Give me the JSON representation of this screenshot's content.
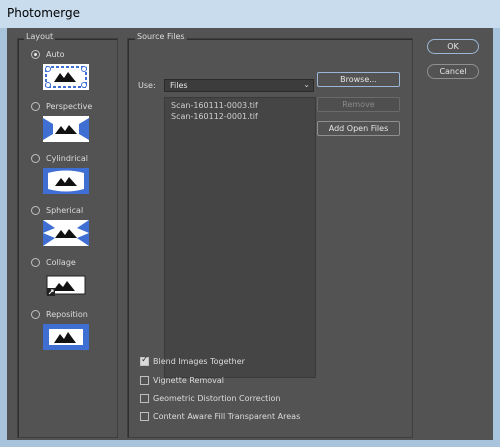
{
  "window": {
    "title": "Photomerge"
  },
  "layout": {
    "label": "Layout",
    "options": [
      {
        "label": "Auto",
        "selected": true,
        "icon": "auto-layout-icon"
      },
      {
        "label": "Perspective",
        "selected": false,
        "icon": "perspective-layout-icon"
      },
      {
        "label": "Cylindrical",
        "selected": false,
        "icon": "cylindrical-layout-icon"
      },
      {
        "label": "Spherical",
        "selected": false,
        "icon": "spherical-layout-icon"
      },
      {
        "label": "Collage",
        "selected": false,
        "icon": "collage-layout-icon"
      },
      {
        "label": "Reposition",
        "selected": false,
        "icon": "reposition-layout-icon"
      }
    ]
  },
  "source": {
    "label": "Source Files",
    "use_label": "Use:",
    "use_value": "Files",
    "files": [
      "Scan-160111-0003.tif",
      "Scan-160112-0001.tif"
    ],
    "browse": "Browse...",
    "remove": "Remove",
    "add_open": "Add Open Files"
  },
  "options": [
    {
      "label": "Blend Images Together",
      "checked": true
    },
    {
      "label": "Vignette Removal",
      "checked": false
    },
    {
      "label": "Geometric Distortion Correction",
      "checked": false
    },
    {
      "label": "Content Aware Fill Transparent Areas",
      "checked": false
    }
  ],
  "buttons": {
    "ok": "OK",
    "cancel": "Cancel"
  },
  "colors": {
    "accent_blue": "#3f6fd3",
    "dialog_bg": "#535353"
  }
}
